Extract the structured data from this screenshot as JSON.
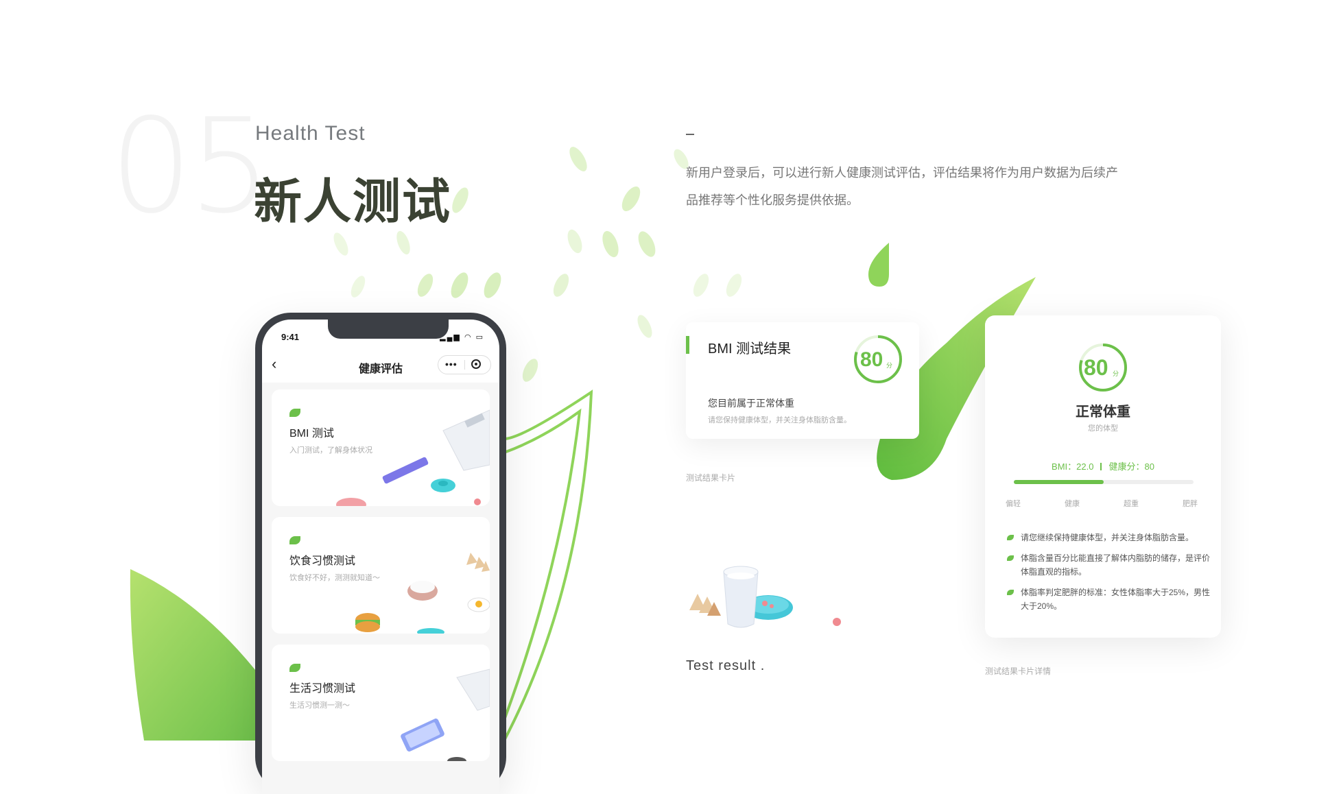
{
  "header": {
    "section_number": "05",
    "subtitle_en": "Health Test",
    "title_cn": "新人测试",
    "description": "新用户登录后，可以进行新人健康测试评估，评估结果将作为用户数据为后续产品推荐等个性化服务提供依据。"
  },
  "phone": {
    "status_time": "9:41",
    "status_icons": "▂▄▆ ◠ ▭",
    "nav_back": "‹",
    "nav_title": "健康评估",
    "capsule_more": "•••",
    "cards": [
      {
        "title": "BMI 测试",
        "subtitle": "入门测试，了解身体状况"
      },
      {
        "title": "饮食习惯测试",
        "subtitle": "饮食好不好，测测就知道～"
      },
      {
        "title": "生活习惯测试",
        "subtitle": "生活习惯测一测～"
      }
    ]
  },
  "bmi_card": {
    "title": "BMI 测试结果",
    "score": "80",
    "score_unit": "分",
    "line1": "您目前属于正常体重",
    "line2": "请您保持健康体型，并关注身体脂肪含量。",
    "caption": "测试结果卡片"
  },
  "detail_card": {
    "score": "80",
    "score_unit": "分",
    "status": "正常体重",
    "type_label": "您的体型",
    "bmi_text": "BMI：22.0",
    "health_text": "健康分：80",
    "progress": 0.5,
    "scale": [
      "偏轻",
      "健康",
      "超重",
      "肥胖"
    ],
    "bullets": [
      "请您继续保持健康体型，并关注身体脂肪含量。",
      "体脂含量百分比能直接了解体内脂肪的储存，是评价体脂直观的指标。",
      "体脂率判定肥胖的标准：女性体脂率大于25%，男性大于20%。"
    ],
    "caption": "测试结果卡片详情"
  },
  "test_result": "Test result .",
  "colors": {
    "accent": "#6cc04a",
    "accent_light": "#a9dc6c",
    "phone_frame": "#3c3f45"
  }
}
